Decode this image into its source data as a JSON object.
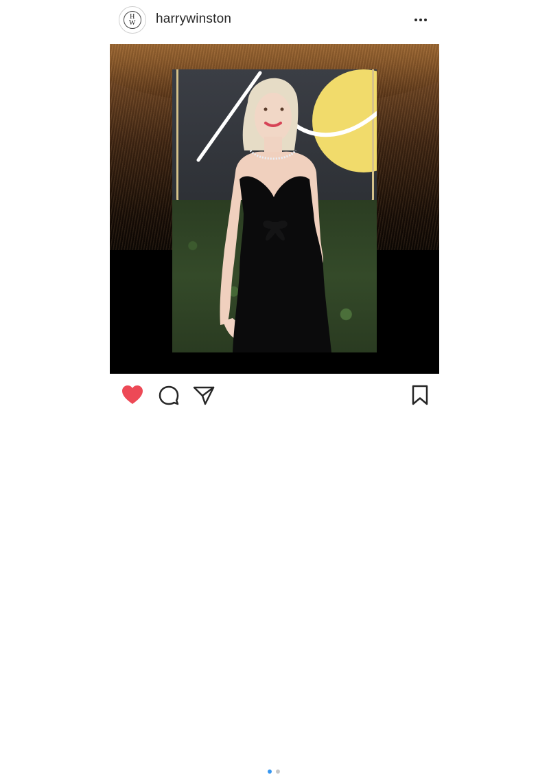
{
  "post": {
    "username": "harrywinston",
    "avatar_monogram_top": "H",
    "avatar_monogram_bottom": "W",
    "carousel": {
      "total": 2,
      "active": 1
    }
  },
  "icons": {
    "more": "more-options-icon",
    "like": "heart-icon",
    "comment": "comment-icon",
    "share": "send-icon",
    "save": "bookmark-icon"
  },
  "colors": {
    "like_active": "#ed4956",
    "text": "#262626",
    "dot_active": "#3897f0",
    "dot_inactive": "#c7c7c7"
  }
}
